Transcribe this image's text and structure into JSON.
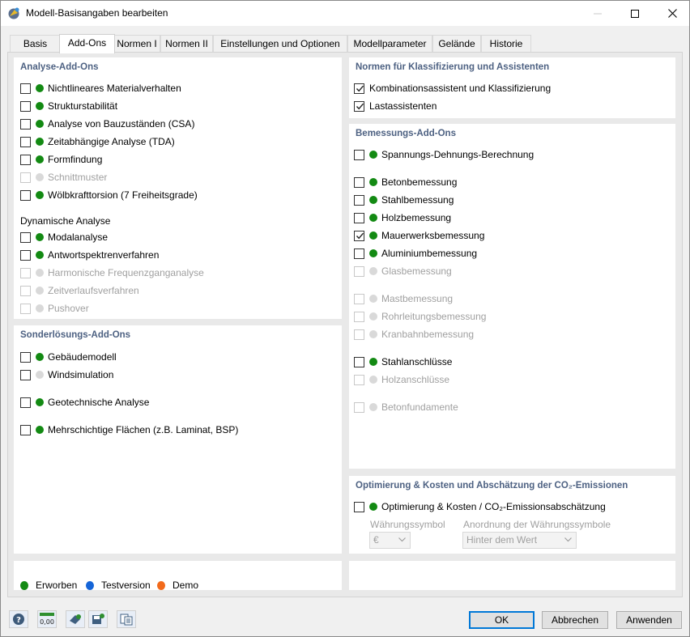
{
  "window": {
    "title": "Modell-Basisangaben bearbeiten"
  },
  "tabs": [
    {
      "label": "Basis",
      "active": false
    },
    {
      "label": "Add-Ons",
      "active": true
    },
    {
      "label": "Normen I",
      "active": false
    },
    {
      "label": "Normen II",
      "active": false
    },
    {
      "label": "Einstellungen und Optionen",
      "active": false
    },
    {
      "label": "Modellparameter",
      "active": false
    },
    {
      "label": "Gelände",
      "active": false
    },
    {
      "label": "Historie",
      "active": false
    }
  ],
  "colors": {
    "acquired": "#138a13",
    "trial": "#1565d8",
    "demo": "#f26a1b",
    "unavailable": "#d9d9d9",
    "panel_title": "#4d6182"
  },
  "analysis_addons": {
    "title": "Analyse-Add-Ons",
    "items": [
      {
        "label": "Nichtlineares Materialverhalten",
        "checked": false,
        "enabled": true,
        "status": "acquired"
      },
      {
        "label": "Strukturstabilität",
        "checked": false,
        "enabled": true,
        "status": "acquired"
      },
      {
        "label": "Analyse von Bauzuständen (CSA)",
        "checked": false,
        "enabled": true,
        "status": "acquired"
      },
      {
        "label": "Zeitabhängige Analyse (TDA)",
        "checked": false,
        "enabled": true,
        "status": "acquired"
      },
      {
        "label": "Formfindung",
        "checked": false,
        "enabled": true,
        "status": "acquired"
      },
      {
        "label": "Schnittmuster",
        "checked": false,
        "enabled": false,
        "status": "unavailable"
      },
      {
        "label": "Wölbkrafttorsion (7 Freiheitsgrade)",
        "checked": false,
        "enabled": true,
        "status": "acquired"
      }
    ],
    "dynamic_label": "Dynamische Analyse",
    "dynamic_items": [
      {
        "label": "Modalanalyse",
        "checked": false,
        "enabled": true,
        "status": "acquired"
      },
      {
        "label": "Antwortspektrenverfahren",
        "checked": false,
        "enabled": true,
        "status": "acquired"
      },
      {
        "label": "Harmonische Frequenzganganalyse",
        "checked": false,
        "enabled": false,
        "status": "unavailable"
      },
      {
        "label": "Zeitverlaufsverfahren",
        "checked": false,
        "enabled": false,
        "status": "unavailable"
      },
      {
        "label": "Pushover",
        "checked": false,
        "enabled": false,
        "status": "unavailable"
      }
    ]
  },
  "special_addons": {
    "title": "Sonderlösungs-Add-Ons",
    "items": [
      {
        "label": "Gebäudemodell",
        "checked": false,
        "enabled": true,
        "status": "acquired"
      },
      {
        "label": "Windsimulation",
        "checked": false,
        "enabled": true,
        "status": "unavailable"
      },
      {
        "label": "Geotechnische Analyse",
        "checked": false,
        "enabled": true,
        "status": "acquired"
      },
      {
        "label": "Mehrschichtige Flächen (z.B. Laminat, BSP)",
        "checked": false,
        "enabled": true,
        "status": "acquired"
      }
    ]
  },
  "standards_classification": {
    "title": "Normen für Klassifizierung und Assistenten",
    "items": [
      {
        "label": "Kombinationsassistent und Klassifizierung",
        "checked": true,
        "enabled": true
      },
      {
        "label": "Lastassistenten",
        "checked": true,
        "enabled": true
      }
    ]
  },
  "design_addons": {
    "title": "Bemessungs-Add-Ons",
    "items": [
      {
        "label": "Spannungs-Dehnungs-Berechnung",
        "checked": false,
        "enabled": true,
        "status": "acquired"
      },
      {
        "label": "Betonbemessung",
        "checked": false,
        "enabled": true,
        "status": "acquired"
      },
      {
        "label": "Stahlbemessung",
        "checked": false,
        "enabled": true,
        "status": "acquired"
      },
      {
        "label": "Holzbemessung",
        "checked": false,
        "enabled": true,
        "status": "acquired"
      },
      {
        "label": "Mauerwerksbemessung",
        "checked": true,
        "enabled": true,
        "status": "acquired"
      },
      {
        "label": "Aluminiumbemessung",
        "checked": false,
        "enabled": true,
        "status": "acquired"
      },
      {
        "label": "Glasbemessung",
        "checked": false,
        "enabled": false,
        "status": "unavailable"
      },
      {
        "label": "Mastbemessung",
        "checked": false,
        "enabled": false,
        "status": "unavailable"
      },
      {
        "label": "Rohrleitungsbemessung",
        "checked": false,
        "enabled": false,
        "status": "unavailable"
      },
      {
        "label": "Kranbahnbemessung",
        "checked": false,
        "enabled": false,
        "status": "unavailable"
      },
      {
        "label": "Stahlanschlüsse",
        "checked": false,
        "enabled": true,
        "status": "acquired"
      },
      {
        "label": "Holzanschlüsse",
        "checked": false,
        "enabled": false,
        "status": "unavailable"
      },
      {
        "label": "Betonfundamente",
        "checked": false,
        "enabled": false,
        "status": "unavailable"
      }
    ]
  },
  "optimization": {
    "title": "Optimierung & Kosten und Abschätzung der CO₂-Emissionen",
    "item": {
      "label": "Optimierung & Kosten / CO₂-Emissionsabschätzung",
      "checked": false,
      "enabled": true,
      "status": "acquired"
    },
    "currency_label": "Währungssymbol",
    "currency_value": "€",
    "arrangement_label": "Anordnung der Währungssymbole",
    "arrangement_value": "Hinter dem Wert"
  },
  "legend": [
    {
      "label": "Erworben",
      "status": "acquired"
    },
    {
      "label": "Testversion",
      "status": "trial"
    },
    {
      "label": "Demo",
      "status": "demo"
    }
  ],
  "toolbar": {
    "icons": [
      "help-icon",
      "units-icon",
      "model-icon",
      "save-template-icon",
      "copy-icon"
    ],
    "units_text": "0,00"
  },
  "buttons": {
    "ok": "OK",
    "cancel": "Abbrechen",
    "apply": "Anwenden"
  }
}
